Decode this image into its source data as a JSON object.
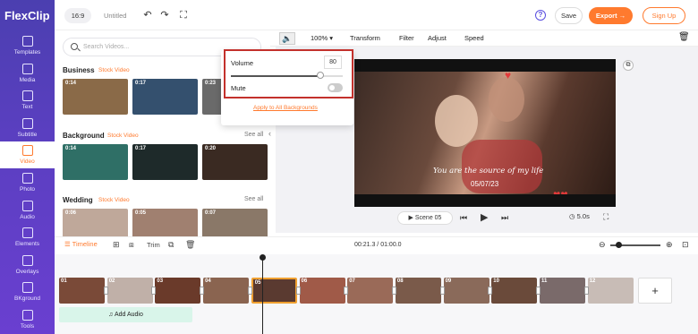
{
  "app": {
    "logo": "FlexClip",
    "ratio": "16:9",
    "title": "Untitled"
  },
  "header": {
    "save": "Save",
    "export": "Export →",
    "signup": "Sign Up",
    "help": "?"
  },
  "nav": [
    {
      "label": "Templates",
      "icon": "templates-icon"
    },
    {
      "label": "Media",
      "icon": "media-icon"
    },
    {
      "label": "Text",
      "icon": "text-icon"
    },
    {
      "label": "Subtitle",
      "icon": "subtitle-icon"
    },
    {
      "label": "Video",
      "icon": "video-icon"
    },
    {
      "label": "Photo",
      "icon": "photo-icon"
    },
    {
      "label": "Audio",
      "icon": "audio-icon"
    },
    {
      "label": "Elements",
      "icon": "elements-icon"
    },
    {
      "label": "Overlays",
      "icon": "overlays-icon"
    },
    {
      "label": "BKground",
      "icon": "background-icon"
    },
    {
      "label": "Tools",
      "icon": "tools-icon"
    }
  ],
  "library": {
    "search_placeholder": "Search Videos...",
    "categories": [
      {
        "name": "Business",
        "sub": "Stock Video",
        "see_all": "",
        "thumbs": [
          "0:14",
          "0:17",
          "0:23"
        ],
        "colors": [
          "#8a6a48",
          "#34506e",
          "#6a6a6a"
        ]
      },
      {
        "name": "Background",
        "sub": "Stock Video",
        "see_all": "See all",
        "thumbs": [
          "0:14",
          "0:17",
          "0:20"
        ],
        "colors": [
          "#2f6f66",
          "#1e2a2a",
          "#3a2a22"
        ]
      },
      {
        "name": "Wedding",
        "sub": "Stock Video",
        "see_all": "See all",
        "thumbs": [
          "0:06",
          "0:05",
          "0:07"
        ],
        "colors": [
          "#bfa89a",
          "#a08070",
          "#8a7868"
        ]
      }
    ]
  },
  "toolbar": {
    "zoom": "100%",
    "transform": "Transform",
    "filter": "Filter",
    "adjust": "Adjust",
    "speed": "Speed"
  },
  "volume_popup": {
    "volume_label": "Volume",
    "volume_value": "80",
    "volume_level": 0.8,
    "mute_label": "Mute",
    "apply_all": "Apply to All Backgrounds"
  },
  "preview": {
    "overlay_text": "You are the source of my life",
    "overlay_date": "05/07/23",
    "scene": "Scene 05",
    "duration": "5.0s"
  },
  "timeline": {
    "tab": "Timeline",
    "trim": "Trim",
    "timecode": "00:21.3 / 01:00.0",
    "clips": [
      {
        "n": "01",
        "c": "#7a4a38"
      },
      {
        "n": "02",
        "c": "#c0b0a8"
      },
      {
        "n": "03",
        "c": "#6a3a2a"
      },
      {
        "n": "04",
        "c": "#8a6450"
      },
      {
        "n": "05",
        "c": "#5a3a30"
      },
      {
        "n": "06",
        "c": "#a05a48"
      },
      {
        "n": "07",
        "c": "#9a6a58"
      },
      {
        "n": "08",
        "c": "#7a5a4a"
      },
      {
        "n": "09",
        "c": "#8a6a5a"
      },
      {
        "n": "10",
        "c": "#6a4a3a"
      },
      {
        "n": "11",
        "c": "#7a6a6a"
      },
      {
        "n": "12",
        "c": "#c8bcb6"
      }
    ],
    "add_audio": "Add Audio"
  }
}
